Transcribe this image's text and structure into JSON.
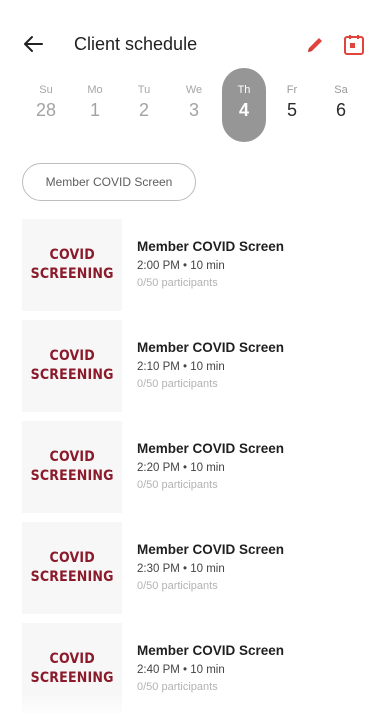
{
  "header": {
    "title": "Client schedule",
    "accent": "#e0443c"
  },
  "week": [
    {
      "name": "Su",
      "date": "28",
      "state": "past"
    },
    {
      "name": "Mo",
      "date": "1",
      "state": "past"
    },
    {
      "name": "Tu",
      "date": "2",
      "state": "past"
    },
    {
      "name": "We",
      "date": "3",
      "state": "past"
    },
    {
      "name": "Th",
      "date": "4",
      "state": "selected"
    },
    {
      "name": "Fr",
      "date": "5",
      "state": "future"
    },
    {
      "name": "Sa",
      "date": "6",
      "state": "future"
    }
  ],
  "filter": {
    "chip_label": "Member COVID Screen"
  },
  "sessions": [
    {
      "thumb_line1": "COVID",
      "thumb_line2": "SCREENING",
      "name": "Member COVID Screen",
      "time": "2:00 PM • 10 min",
      "participants": "0/50 participants"
    },
    {
      "thumb_line1": "COVID",
      "thumb_line2": "SCREENING",
      "name": "Member COVID Screen",
      "time": "2:10 PM • 10 min",
      "participants": "0/50 participants"
    },
    {
      "thumb_line1": "COVID",
      "thumb_line2": "SCREENING",
      "name": "Member COVID Screen",
      "time": "2:20 PM • 10 min",
      "participants": "0/50 participants"
    },
    {
      "thumb_line1": "COVID",
      "thumb_line2": "SCREENING",
      "name": "Member COVID Screen",
      "time": "2:30 PM • 10 min",
      "participants": "0/50 participants"
    },
    {
      "thumb_line1": "COVID",
      "thumb_line2": "SCREENING",
      "name": "Member COVID Screen",
      "time": "2:40 PM • 10 min",
      "participants": "0/50 participants"
    }
  ]
}
